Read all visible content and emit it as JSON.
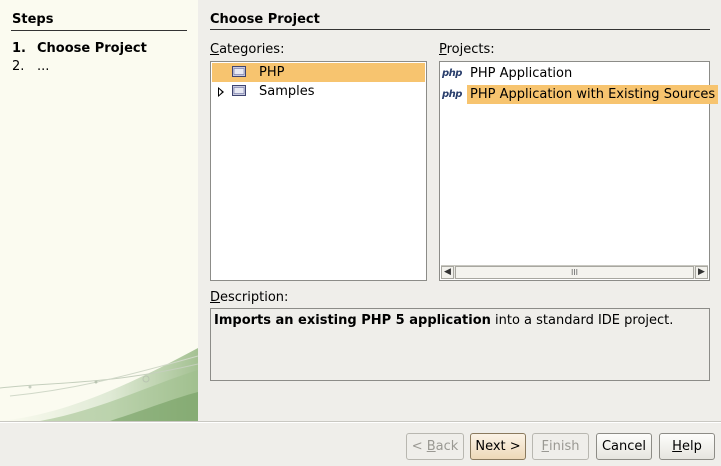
{
  "steps": {
    "title": "Steps",
    "items": [
      {
        "num": "1.",
        "label": "Choose Project"
      },
      {
        "num": "2.",
        "label": "..."
      }
    ]
  },
  "main": {
    "title": "Choose Project"
  },
  "categories": {
    "label_mnemonic": "C",
    "label_rest": "ategories:",
    "items": [
      {
        "label": "PHP",
        "icon": "folder-icon",
        "selected": true
      },
      {
        "label": "Samples",
        "icon": "folder-icon",
        "selected": false,
        "expandable": true
      }
    ]
  },
  "projects": {
    "label_mnemonic": "P",
    "label_rest": "rojects:",
    "icon_text": "php",
    "items": [
      {
        "label": "PHP Application",
        "icon": "php-icon",
        "selected": false
      },
      {
        "label": "PHP Application with Existing Sources",
        "icon": "php-icon",
        "selected": true
      }
    ],
    "scrollbar_grip": "III"
  },
  "description": {
    "label_mnemonic": "D",
    "label_rest": "escription:",
    "bold_text": "Imports an existing PHP 5 application",
    "rest_text": " into a standard IDE project."
  },
  "buttons": {
    "back": {
      "pre": "< ",
      "mnemonic": "B",
      "post": "ack",
      "enabled": false
    },
    "next": {
      "pre": "Next >",
      "mnemonic": "",
      "post": "",
      "enabled": true
    },
    "finish": {
      "pre": "",
      "mnemonic": "F",
      "post": "inish",
      "enabled": false
    },
    "cancel": {
      "pre": "Cancel",
      "mnemonic": "",
      "post": "",
      "enabled": true
    },
    "help": {
      "pre": "",
      "mnemonic": "H",
      "post": "elp",
      "enabled": true
    }
  },
  "colors": {
    "selection": "#f7c46f",
    "left_panel": "#fbfbf0",
    "dialog_bg": "#efeeea"
  }
}
